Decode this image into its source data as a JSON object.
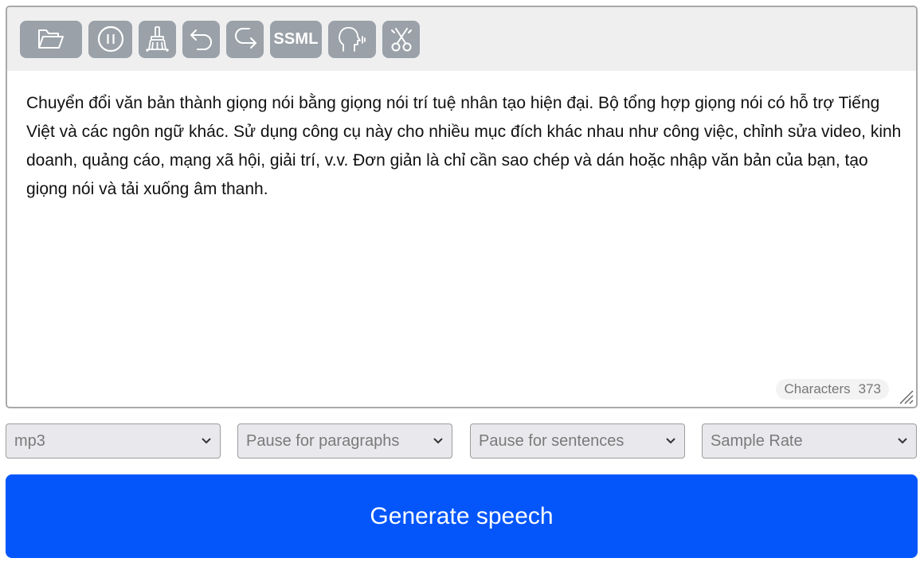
{
  "toolbar": {
    "buttons": [
      {
        "name": "open-file-button",
        "icon": "folder-open-icon"
      },
      {
        "name": "pause-button",
        "icon": "pause-icon"
      },
      {
        "name": "clear-button",
        "icon": "broom-icon"
      },
      {
        "name": "undo-button",
        "icon": "undo-icon"
      },
      {
        "name": "redo-button",
        "icon": "redo-icon"
      },
      {
        "name": "ssml-button",
        "label": "SSML"
      },
      {
        "name": "voice-button",
        "icon": "speaking-head-icon"
      },
      {
        "name": "cut-button",
        "icon": "scissors-icon"
      }
    ],
    "ssml_label": "SSML"
  },
  "editor": {
    "text": "Chuyển đổi văn bản thành giọng nói bằng giọng nói trí tuệ nhân tạo hiện đại. Bộ tổng hợp giọng nói có hỗ trợ Tiếng Việt và các ngôn ngữ khác. Sử dụng công cụ này cho nhiều mục đích khác nhau như công việc, chỉnh sửa video, kinh doanh, quảng cáo, mạng xã hội, giải trí, v.v. Đơn giản là chỉ cần sao chép và dán hoặc nhập văn bản của bạn, tạo giọng nói và tải xuống âm thanh.",
    "characters_label": "Characters",
    "characters_count": "373"
  },
  "options": {
    "format": "mp3",
    "pause_paragraphs": "Pause for paragraphs",
    "pause_sentences": "Pause for sentences",
    "sample_rate": "Sample Rate"
  },
  "generate_label": "Generate speech",
  "colors": {
    "toolbar_button": "#9aa1a8",
    "toolbar_bg": "#efefef",
    "accent": "#0456fb"
  }
}
